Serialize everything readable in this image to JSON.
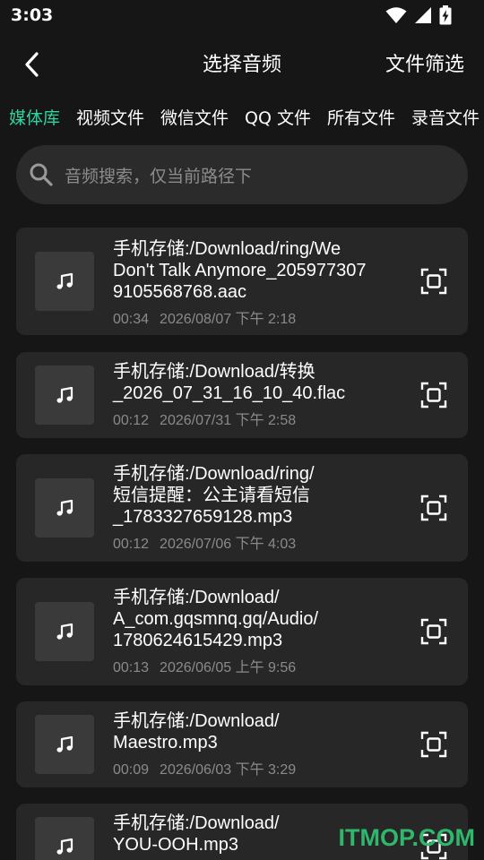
{
  "status_bar": {
    "time": "3:03",
    "icons": [
      "wifi-icon",
      "signal-icon",
      "battery-charging-icon"
    ]
  },
  "header": {
    "title": "选择音频",
    "filter_label": "文件筛选",
    "back_icon": "chevron-left-icon"
  },
  "tabs": [
    {
      "label": "媒体库",
      "active": true
    },
    {
      "label": "视频文件",
      "active": false
    },
    {
      "label": "微信文件",
      "active": false
    },
    {
      "label": "QQ 文件",
      "active": false
    },
    {
      "label": "所有文件",
      "active": false
    },
    {
      "label": "录音文件",
      "active": false
    }
  ],
  "search": {
    "placeholder": "音频搜索，仅当前路径下",
    "icon": "search-icon"
  },
  "files": [
    {
      "title": "手机存储:/Download/ring/We\nDon't Talk Anymore_205977307\n9105568768.aac",
      "duration": "00:34",
      "date": "2026/08/07 下午 2:18"
    },
    {
      "title": "手机存储:/Download/转换\n_2026_07_31_16_10_40.flac",
      "duration": "00:12",
      "date": "2026/07/31 下午 2:58"
    },
    {
      "title": "手机存储:/Download/ring/\n短信提醒：公主请看短信\n_1783327659128.mp3",
      "duration": "00:12",
      "date": "2026/07/06 下午 4:03"
    },
    {
      "title": "手机存储:/Download/\nA_com.gqsmnq.gq/Audio/\n1780624615429.mp3",
      "duration": "00:13",
      "date": "2026/06/05 上午 9:56"
    },
    {
      "title": "手机存储:/Download/\nMaestro.mp3",
      "duration": "00:09",
      "date": "2026/06/03 下午 3:29"
    },
    {
      "title": "手机存储:/Download/\nYOU-OOH.mp3",
      "duration": "",
      "date": ""
    }
  ],
  "watermark": "ITMOP.COM",
  "colors": {
    "background": "#161616",
    "card": "#272727",
    "accent_tab": "#2fd3a0",
    "watermark": "#2fb86b"
  }
}
